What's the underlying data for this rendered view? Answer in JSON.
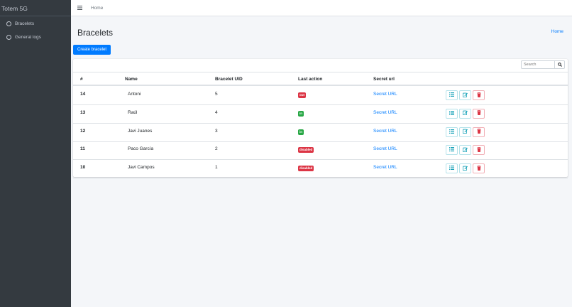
{
  "sidebar": {
    "brand": "Totem 5G",
    "items": [
      {
        "label": "Bracelets"
      },
      {
        "label": "General logs"
      }
    ]
  },
  "topbar": {
    "home": "Home"
  },
  "page": {
    "title": "Bracelets",
    "breadcrumb": "Home"
  },
  "create_button": "Create bracelet",
  "search": {
    "placeholder": "Search"
  },
  "table": {
    "headers": [
      "#",
      "Name",
      "Bracelet UID",
      "Last action",
      "Secret url"
    ],
    "rows": [
      {
        "id": "14",
        "name": "Antoni",
        "uid": "5",
        "action": "out",
        "action_color": "#dc3545",
        "url": "Secret URL"
      },
      {
        "id": "13",
        "name": "Raúl",
        "uid": "4",
        "action": "in",
        "action_color": "#28a745",
        "url": "Secret URL"
      },
      {
        "id": "12",
        "name": "Javi Juanes",
        "uid": "3",
        "action": "in",
        "action_color": "#28a745",
        "url": "Secret URL"
      },
      {
        "id": "11",
        "name": "Paco García",
        "uid": "2",
        "action": "disabled",
        "action_color": "#dc3545",
        "url": "Secret URL"
      },
      {
        "id": "10",
        "name": "Javi Campos",
        "uid": "1",
        "action": "disabled",
        "action_color": "#dc3545",
        "url": "Secret URL"
      }
    ]
  },
  "icons": {
    "menu": "hamburger-icon",
    "search": "search-icon",
    "details": "list-icon",
    "edit": "edit-icon",
    "delete": "trash-icon"
  },
  "colors": {
    "primary": "#007bff",
    "danger": "#dc3545",
    "success": "#28a745",
    "sidebar": "#343a40",
    "info": "#17a2b8"
  }
}
